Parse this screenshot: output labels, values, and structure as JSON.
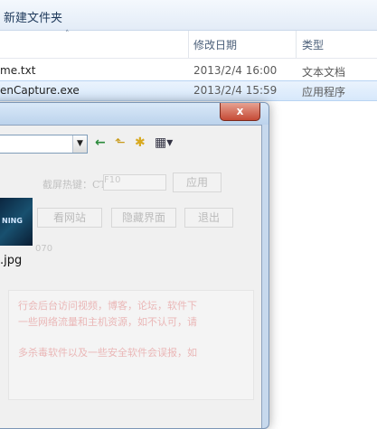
{
  "explorer": {
    "command_label": "新建文件夹",
    "columns": {
      "date": "修改日期",
      "type": "类型",
      "sort_glyph": "˄"
    },
    "files": [
      {
        "name": "me.txt",
        "date": "2013/2/4 16:00",
        "type": "文本文档"
      },
      {
        "name": "enCapture.exe",
        "date": "2013/2/4 15:59",
        "type": "应用程序"
      }
    ]
  },
  "dialog": {
    "close_glyph": "x",
    "toolbar": {
      "back_icon": "←",
      "up_icon": "⬑",
      "newfolder_icon": "✱",
      "views_icon": "▦▾"
    },
    "bg_app": {
      "hotkey_label": "截屏热键：CTRL+",
      "hotkey_value": "F10",
      "apply_label": "应用",
      "site_label": "看网站",
      "hide_label": "隐藏界面",
      "exit_label": "退出",
      "version": "070",
      "notice_lines": [
        "行会后台访问视频，博客，论坛，软件下",
        "一些网络流量和主机资源，如不认可，请",
        "",
        "多杀毒软件以及一些安全软件会误报，如"
      ]
    },
    "thumb_text": "NING",
    "file_name": ".jpg"
  }
}
